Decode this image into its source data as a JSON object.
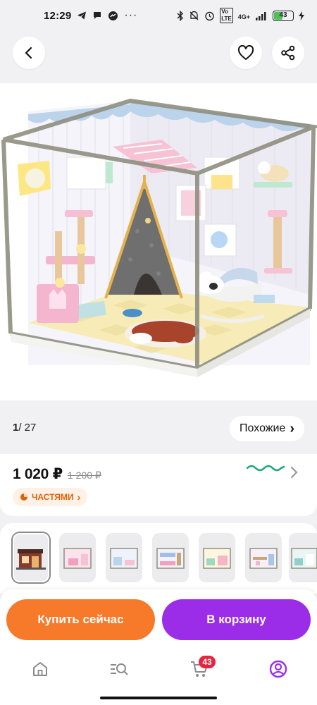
{
  "status_bar": {
    "time": "12:29",
    "left_icons": [
      "telegram-icon",
      "chat-icon",
      "messenger-icon",
      "more-dots-icon"
    ],
    "right_icons": [
      "bluetooth-icon",
      "mute-icon",
      "alarm-icon",
      "volte-icon",
      "signal-icon"
    ],
    "network": "4G+",
    "battery": "43",
    "battery_level": 0.43
  },
  "header": {
    "back_icon": "arrow-left-icon",
    "favorite_icon": "heart-icon",
    "share_icon": "share-icon"
  },
  "gallery": {
    "current": "1",
    "total": "/ 27",
    "similar_label": "Похожие",
    "similar_chevron": "›"
  },
  "price": {
    "current": "1 020 ₽",
    "old": "1 200 ₽",
    "installment_label": "ЧАСТЯМИ",
    "installment_chevron": "›",
    "accent_color": "#f67a2a"
  },
  "variants": {
    "count": 7,
    "items": [
      "variant-shop-house",
      "variant-pink-room",
      "variant-blue-room",
      "variant-bunk-room",
      "variant-pastel-room",
      "variant-study-room",
      "variant-kitchen-room"
    ]
  },
  "actions": {
    "buy_now": "Купить сейчас",
    "add_to_cart": "В корзину",
    "buy_color": "#f67a2a",
    "cart_color": "#9b2de8"
  },
  "bottom_nav": {
    "items": [
      "home-icon",
      "catalog-search-icon",
      "cart-icon",
      "profile-icon"
    ],
    "cart_badge": "43",
    "active_color": "#9b2de8"
  }
}
